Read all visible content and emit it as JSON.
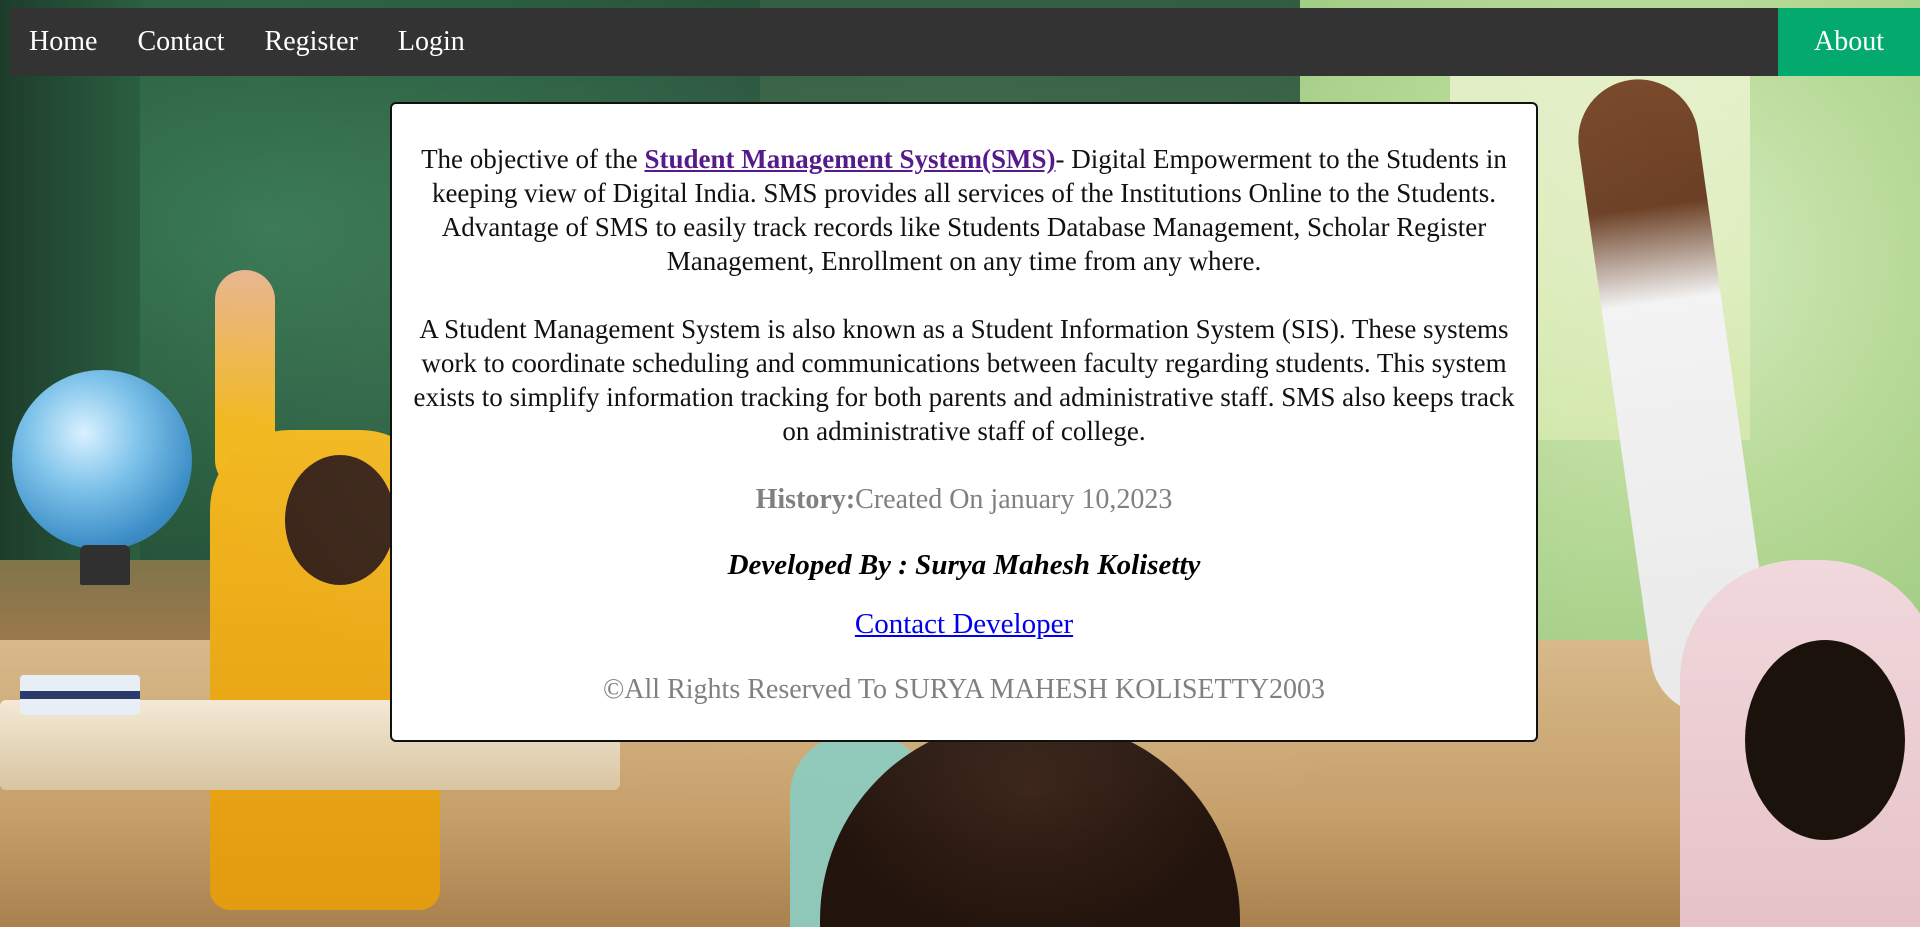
{
  "nav": {
    "home": "Home",
    "contact": "Contact",
    "register": "Register",
    "login": "Login",
    "about": "About"
  },
  "card": {
    "intro_prefix": "The objective of the ",
    "sms_link": "Student Management System(SMS)",
    "intro_suffix": "- Digital Empowerment to the Students in keeping view of Digital India. SMS provides all services of the Institutions Online to the Students. Advantage of SMS to easily track records like Students Database Management, Scholar Register Management, Enrollment on any time from any where.",
    "paragraph_2": "A Student Management System is also known as a Student Information System (SIS). These systems work to coordinate scheduling and communications between faculty regarding students. This system exists to simplify information tracking for both parents and administrative staff. SMS also keeps track on administrative staff of college.",
    "history_label": "History:",
    "history_value": "Created On january 10,2023",
    "developed_by": "Developed By : Surya Mahesh Kolisetty",
    "contact_developer": "Contact Developer",
    "copyright": "©All Rights Reserved To SURYA MAHESH KOLISETTY2003"
  },
  "colors": {
    "navbar": "#333333",
    "about_active": "#04aa6d",
    "sms_link": "#551a8b",
    "contact_link": "#0000ee",
    "muted_text": "#808080"
  }
}
